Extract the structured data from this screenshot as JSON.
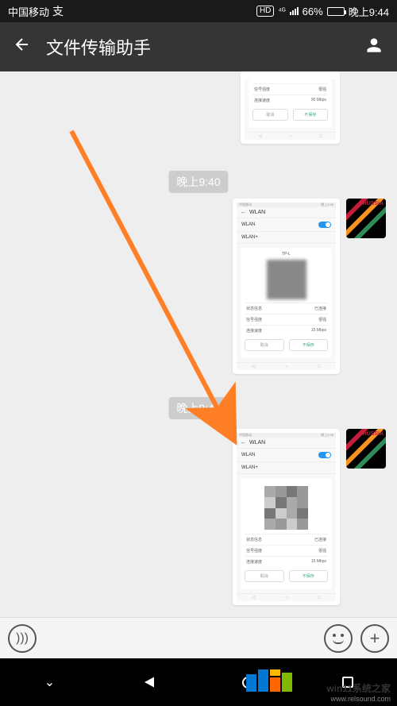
{
  "status_bar": {
    "carrier": "中国移动",
    "network_4g": "4G",
    "hd_label": "HD",
    "battery_percent": "66%",
    "time": "晚上9:44"
  },
  "header": {
    "title": "文件传输助手"
  },
  "timestamps": {
    "t1": "晚上9:40",
    "t2": "晚上9:44"
  },
  "mini_screen": {
    "wlan_title": "WLAN",
    "wlan_label": "WLAN",
    "wlan_plus": "WLAN+",
    "network_name": "TP-L",
    "row1_label": "状态信息",
    "row1_value": "已连接",
    "row2_label": "信号强度",
    "row2_value": "很强",
    "row3_label": "连接速度",
    "row3_value": "15 Mbps",
    "btn_cancel": "取消",
    "btn_forget": "不保存"
  },
  "avatar": {
    "text": "RUSSIA"
  },
  "watermark": {
    "line1": "win11系统之家",
    "line2": "www.relsound.com"
  }
}
